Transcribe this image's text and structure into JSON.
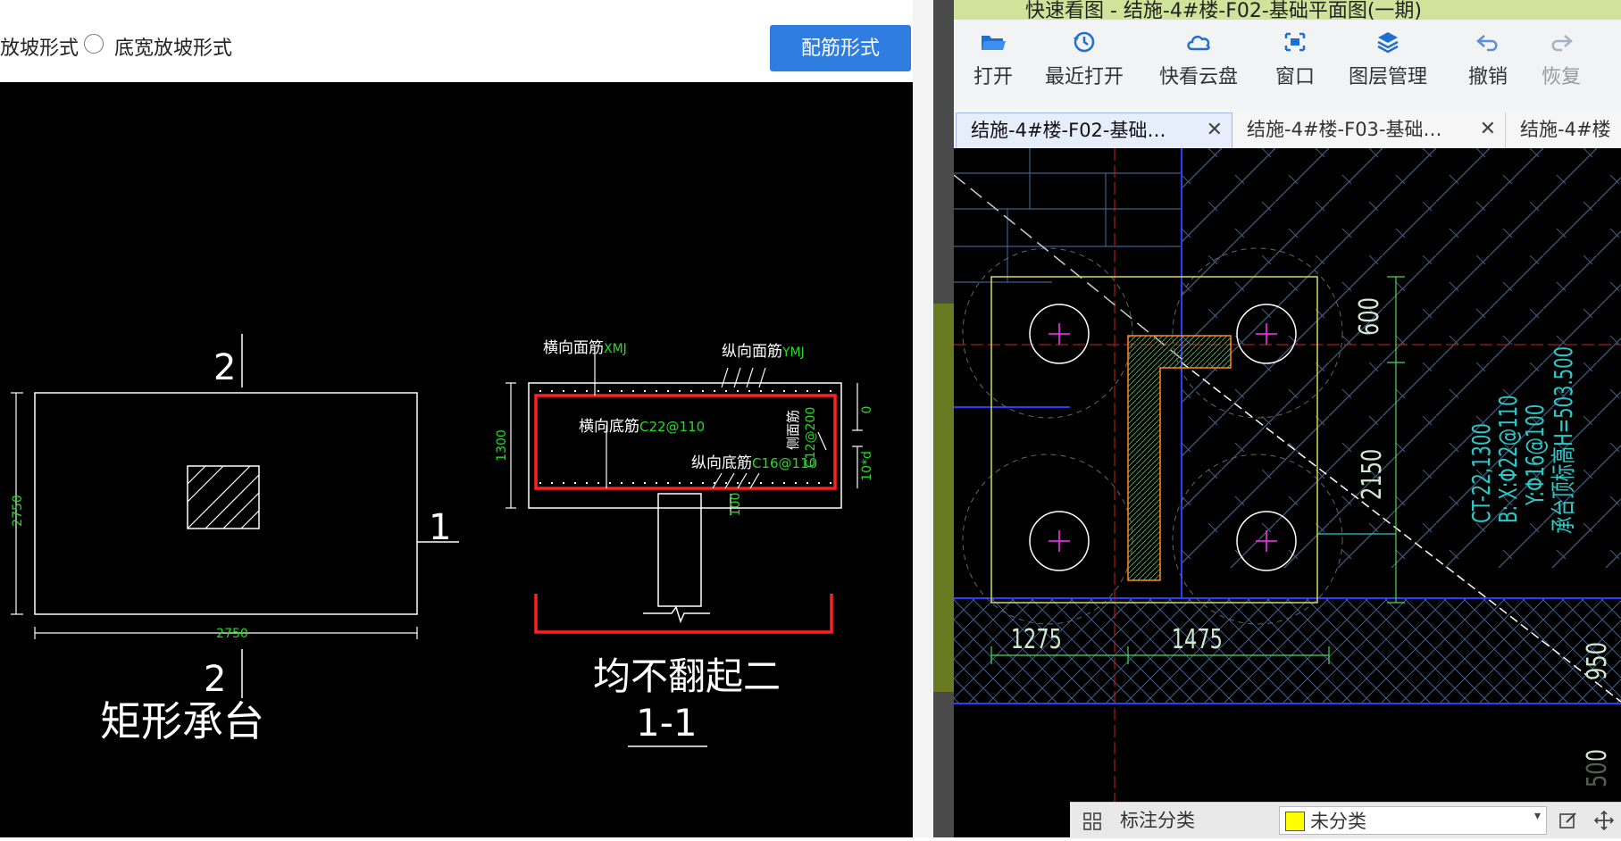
{
  "left_panel": {
    "radio_options": [
      {
        "label": "放坡形式",
        "selected": false
      },
      {
        "label": "底宽放坡形式",
        "selected": false
      }
    ],
    "rebar_button_label": "配筋形式",
    "drawing": {
      "section_mark_top": "2",
      "section_mark_bottom": "2",
      "section_mark_side": "1",
      "dim_height": "2750",
      "dim_width": "2750",
      "plan_title": "矩形承台",
      "label_transverse_top": "横向面筋",
      "label_transverse_top_code": "XMJ",
      "label_longitudinal_top": "纵向面筋",
      "label_longitudinal_top_code": "YMJ",
      "label_transverse_bottom": "横向底筋",
      "label_transverse_bottom_value": "C22@110",
      "label_longitudinal_bottom": "纵向底筋",
      "label_longitudinal_bottom_value": "C16@110",
      "label_side_rebar": "侧面筋",
      "label_side_rebar_value": "C12@200",
      "dim_depth": "1300",
      "dim_top": "0",
      "dim_side": "10*d",
      "dim_bottom": "100",
      "section_note": "均不翻起二",
      "section_title": "1-1"
    }
  },
  "right_panel": {
    "window_title": "快速看图 - 结施-4#楼-F02-基础平面图(一期)",
    "toolbar": [
      {
        "label": "打开",
        "icon": "folder-open-icon"
      },
      {
        "label": "最近打开",
        "icon": "history-icon"
      },
      {
        "label": "快看云盘",
        "icon": "cloud-icon"
      },
      {
        "label": "窗口",
        "icon": "window-icon"
      },
      {
        "label": "图层管理",
        "icon": "layers-icon"
      },
      {
        "label": "撤销",
        "icon": "undo-icon"
      },
      {
        "label": "恢复",
        "icon": "redo-icon"
      }
    ],
    "tabs": [
      {
        "label": "结施-4#楼-F02-基础…",
        "active": true
      },
      {
        "label": "结施-4#楼-F03-基础…",
        "active": false
      },
      {
        "label": "结施-4#楼",
        "active": false
      }
    ],
    "drawing": {
      "dim_600": "600",
      "dim_2150": "2150",
      "dim_1275": "1275",
      "dim_1475": "1475",
      "dim_950": "950",
      "dim_500": "500",
      "annot_line1": "CT-22,1300",
      "annot_line2": "B: X:Φ22@110",
      "annot_line3": "Y:Φ16@100",
      "annot_line4": "承台顶标高H=503.500"
    },
    "status_bar": {
      "label": "标注分类",
      "category": "未分类",
      "category_color": "#ffff00"
    }
  }
}
